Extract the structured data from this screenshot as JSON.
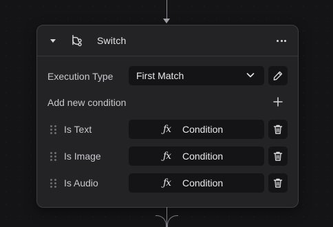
{
  "node": {
    "title": "Switch",
    "header_icon": "switch-branch-icon",
    "menu_icon": "more-horizontal-icon",
    "collapse_icon": "caret-down-icon"
  },
  "execution_type": {
    "label": "Execution Type",
    "selected": "First Match",
    "dropdown_icon": "chevron-down-icon",
    "edit_icon": "pencil-icon"
  },
  "add_condition": {
    "label": "Add new condition",
    "icon": "plus-icon"
  },
  "conditions": [
    {
      "name": "Is Text",
      "button_label": "Condition",
      "button_icon": "function-fx-icon",
      "delete_icon": "trash-icon"
    },
    {
      "name": "Is Image",
      "button_label": "Condition",
      "button_icon": "function-fx-icon",
      "delete_icon": "trash-icon"
    },
    {
      "name": "Is Audio",
      "button_label": "Condition",
      "button_icon": "function-fx-icon",
      "delete_icon": "trash-icon"
    }
  ],
  "fx_glyph": "ƒx",
  "colors": {
    "canvas": "#141416",
    "node_bg": "#232326",
    "node_border": "#3d3d42",
    "field_bg": "#141416",
    "text": "#e9e9ee",
    "muted_text": "#c8c8ce",
    "edge": "#8d8d94"
  }
}
